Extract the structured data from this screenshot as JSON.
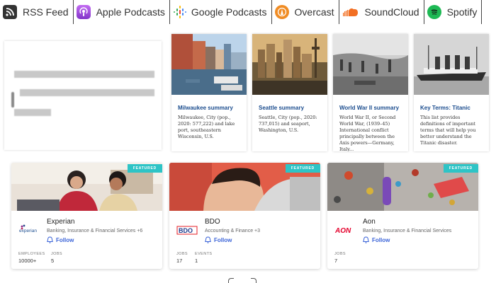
{
  "podcasts": [
    {
      "label": "RSS Feed",
      "icon": "rss-icon"
    },
    {
      "label": "Apple Podcasts",
      "icon": "apple-podcasts-icon"
    },
    {
      "label": "Google Podcasts",
      "icon": "google-podcasts-icon"
    },
    {
      "label": "Overcast",
      "icon": "overcast-icon"
    },
    {
      "label": "SoundCloud",
      "icon": "soundcloud-icon"
    },
    {
      "label": "Spotify",
      "icon": "spotify-icon"
    }
  ],
  "colors": {
    "link_blue": "#1d4e8f",
    "follow_blue": "#3a63d8",
    "featured_teal": "#2ec4c6",
    "apple_purple": "#9a48d8",
    "overcast_orange": "#f08c24",
    "soundcloud_orange": "#f26f23",
    "spotify_green": "#1db954"
  },
  "summaries": [
    {
      "title": "Milwaukee summary",
      "desc": "Milwaukee, City (pop., 2020: 577,222) and lake port, southeastern Wisconsin, U.S."
    },
    {
      "title": "Seattle summary",
      "desc": "Seattle, City (pop., 2020: 737,015) and seaport, Washington, U.S."
    },
    {
      "title": "World War II summary",
      "desc": "World War II, or Second World War, (1939–45) International conflict principally between the Axis powers—Germany, Italy..."
    },
    {
      "title": "Key Terms: Titanic",
      "desc": "This list provides definitions of important terms that will help you better understand the Titanic disaster."
    }
  ],
  "companies": [
    {
      "featured": "FEATURED",
      "name": "Experian",
      "logo_text": "experian",
      "industry": "Banking, Insurance & Financial Services +6",
      "follow": "Follow",
      "stats": [
        {
          "k": "EMPLOYEES",
          "v": "10000+"
        },
        {
          "k": "JOBS",
          "v": "5"
        }
      ]
    },
    {
      "featured": "FEATURED",
      "name": "BDO",
      "logo_text": "BDO",
      "industry": "Accounting & Finance +3",
      "follow": "Follow",
      "stats": [
        {
          "k": "JOBS",
          "v": "17"
        },
        {
          "k": "EVENTS",
          "v": "1"
        }
      ]
    },
    {
      "featured": "FEATURED",
      "name": "Aon",
      "logo_text": "AON",
      "industry": "Banking, Insurance & Financial Services",
      "follow": "Follow",
      "stats": [
        {
          "k": "JOBS",
          "v": "7"
        }
      ]
    }
  ]
}
